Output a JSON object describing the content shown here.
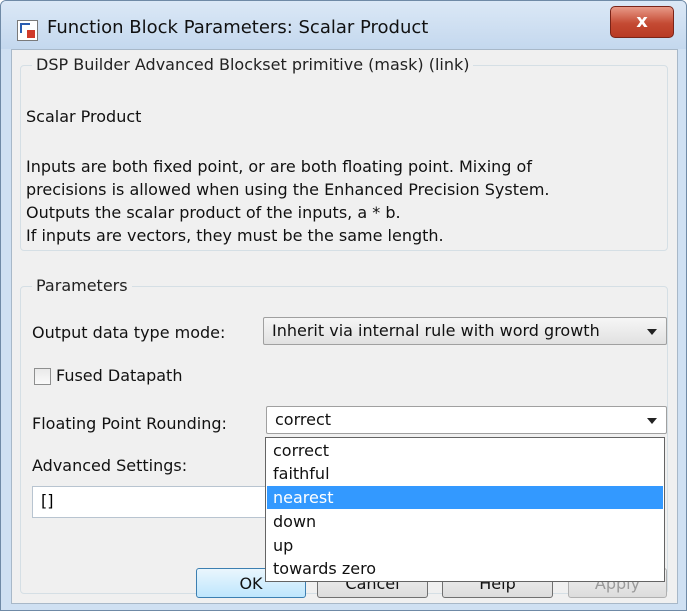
{
  "window": {
    "title": "Function Block Parameters: Scalar Product",
    "close_glyph": "x"
  },
  "mask_group": {
    "legend": "DSP Builder Advanced Blockset primitive (mask) (link)",
    "block_name": "Scalar Product",
    "description": [
      "Inputs are both fixed point, or are both floating point. Mixing of",
      "precisions is allowed when using the Enhanced Precision System.",
      "Outputs the scalar product of the inputs, a * b.",
      "If inputs are vectors, they must be the same length."
    ]
  },
  "parameters": {
    "legend": "Parameters",
    "output_mode_label": "Output data type mode:",
    "output_mode_value": "Inherit via internal rule with word growth",
    "fused_label": "Fused Datapath",
    "fused_checked": false,
    "rounding_label": "Floating Point Rounding:",
    "rounding_value": "correct",
    "advanced_label": "Advanced Settings:",
    "advanced_value": "[]"
  },
  "dropdown_options": [
    "correct",
    "faithful",
    "nearest",
    "down",
    "up",
    "towards zero"
  ],
  "dropdown_highlighted": "nearest",
  "buttons": {
    "ok": "OK",
    "cancel": "Cancel",
    "help": "Help",
    "apply": "Apply"
  }
}
